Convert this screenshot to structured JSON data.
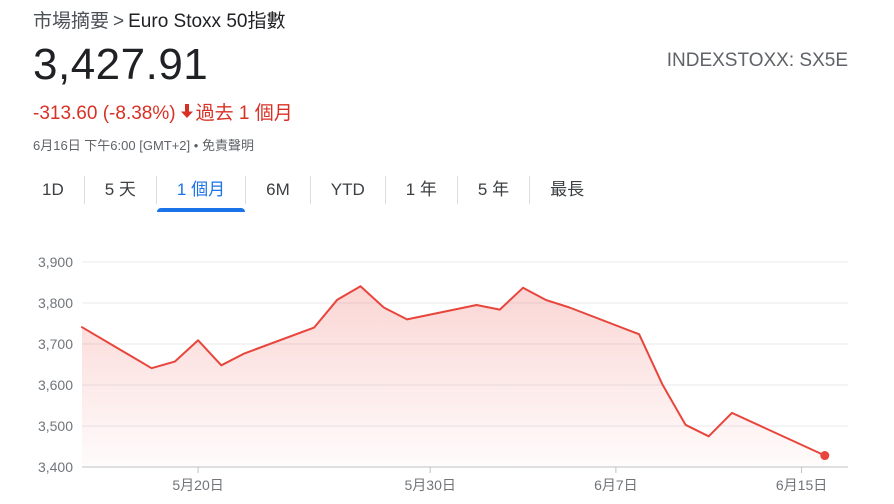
{
  "breadcrumb": {
    "root": "市場摘要",
    "separator": ">",
    "current": "Euro Stoxx 50指數"
  },
  "quote": {
    "price": "3,427.91",
    "ticker": "INDEXSTOXX: SX5E",
    "change": "-313.60 (-8.38%)",
    "period": "過去 1 個月",
    "timestamp": "6月16日 下午6:00 [GMT+2] •",
    "disclaimer": "免責聲明"
  },
  "tabs": [
    {
      "label": "1D"
    },
    {
      "label": "5 天"
    },
    {
      "label": "1 個月",
      "active": true
    },
    {
      "label": "6M"
    },
    {
      "label": "YTD"
    },
    {
      "label": "1 年"
    },
    {
      "label": "5 年"
    },
    {
      "label": "最長"
    }
  ],
  "colors": {
    "accent": "#1a73e8",
    "negative": "#d93025",
    "line": "#e8453c"
  },
  "chart_data": {
    "type": "area",
    "ylim": [
      3400,
      3900
    ],
    "yticks": [
      3400,
      3500,
      3600,
      3700,
      3800,
      3900
    ],
    "ytick_labels": [
      "3,400",
      "3,500",
      "3,600",
      "3,700",
      "3,800",
      "3,900"
    ],
    "x_range": [
      "2020-05-15",
      "2020-06-17"
    ],
    "xticks": [
      {
        "date": "2020-05-20",
        "label": "5月20日"
      },
      {
        "date": "2020-05-30",
        "label": "5月30日"
      },
      {
        "date": "2020-06-07",
        "label": "6月7日"
      },
      {
        "date": "2020-06-15",
        "label": "6月15日"
      }
    ],
    "grid": true,
    "series": [
      {
        "points": [
          [
            "2020-05-15",
            3741
          ],
          [
            "2020-05-18",
            3641
          ],
          [
            "2020-05-19",
            3657
          ],
          [
            "2020-05-20",
            3709
          ],
          [
            "2020-05-21",
            3648
          ],
          [
            "2020-05-22",
            3677
          ],
          [
            "2020-05-25",
            3740
          ],
          [
            "2020-05-26",
            3808
          ],
          [
            "2020-05-27",
            3841
          ],
          [
            "2020-05-28",
            3789
          ],
          [
            "2020-05-29",
            3760
          ],
          [
            "2020-06-01",
            3795
          ],
          [
            "2020-06-02",
            3784
          ],
          [
            "2020-06-03",
            3837
          ],
          [
            "2020-06-04",
            3807
          ],
          [
            "2020-06-05",
            3789
          ],
          [
            "2020-06-08",
            3724
          ],
          [
            "2020-06-09",
            3602
          ],
          [
            "2020-06-10",
            3503
          ],
          [
            "2020-06-11",
            3475
          ],
          [
            "2020-06-12",
            3532
          ],
          [
            "2020-06-16",
            3428
          ]
        ]
      }
    ]
  }
}
